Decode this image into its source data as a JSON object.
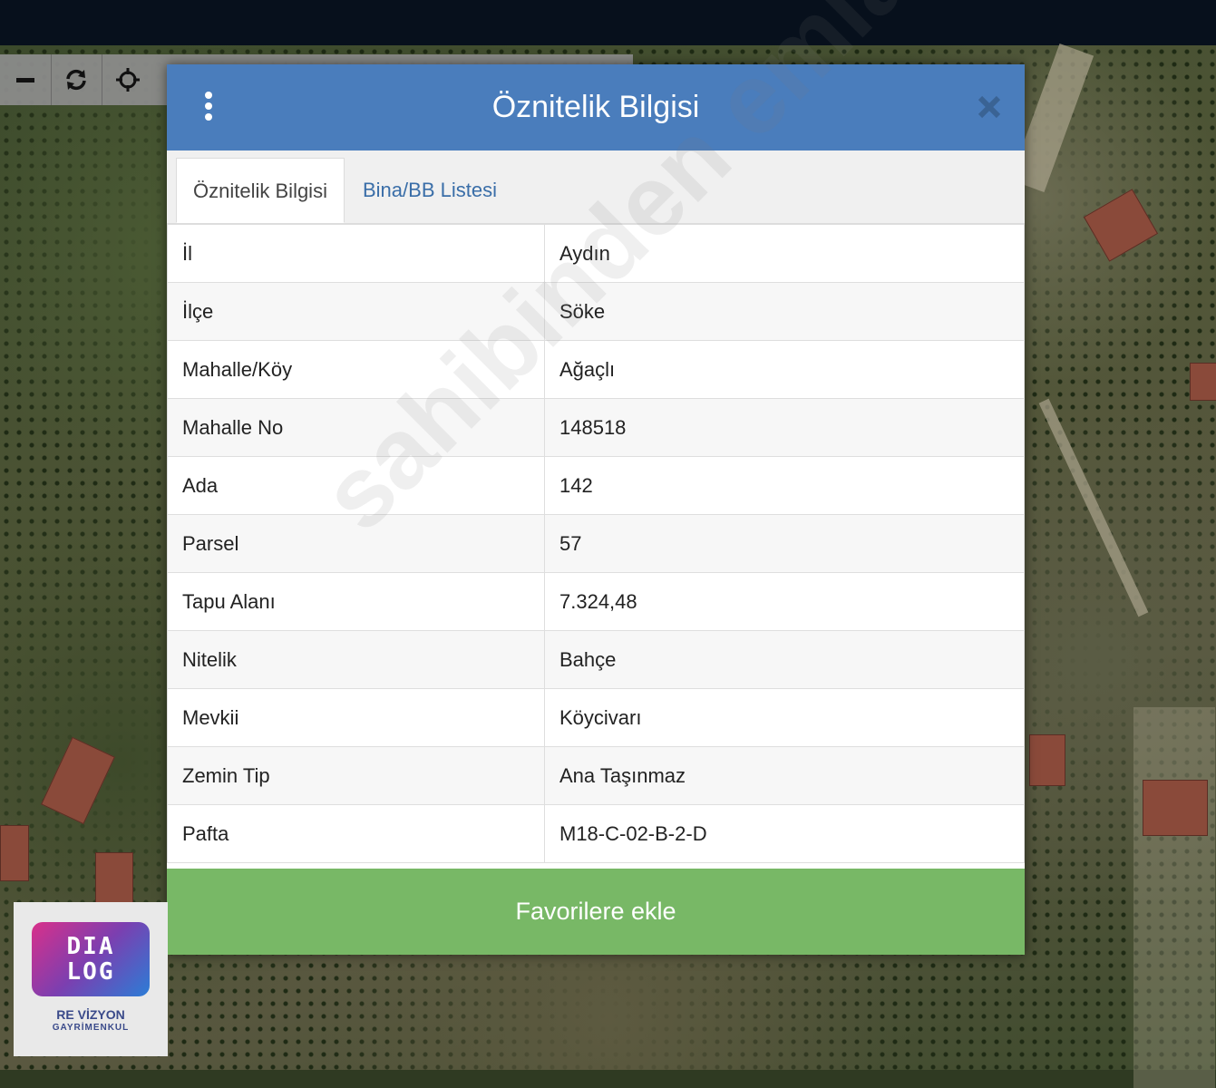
{
  "dialog": {
    "title": "Öznitelik Bilgisi",
    "tabs": [
      {
        "label": "Öznitelik Bilgisi",
        "active": true
      },
      {
        "label": "Bina/BB Listesi",
        "active": false
      }
    ],
    "rows": [
      {
        "key": "İl",
        "value": "Aydın"
      },
      {
        "key": "İlçe",
        "value": "Söke"
      },
      {
        "key": "Mahalle/Köy",
        "value": "Ağaçlı"
      },
      {
        "key": "Mahalle No",
        "value": "148518"
      },
      {
        "key": "Ada",
        "value": "142"
      },
      {
        "key": "Parsel",
        "value": "57"
      },
      {
        "key": "Tapu Alanı",
        "value": "7.324,48"
      },
      {
        "key": "Nitelik",
        "value": "Bahçe"
      },
      {
        "key": "Mevkii",
        "value": "Köycivarı"
      },
      {
        "key": "Zemin Tip",
        "value": "Ana Taşınmaz"
      },
      {
        "key": "Pafta",
        "value": "M18-C-02-B-2-D"
      }
    ],
    "favorite_button": "Favorilere ekle"
  },
  "map_toolbar": {
    "icons": [
      "zoom-out-icon",
      "refresh-icon",
      "locate-icon"
    ]
  },
  "watermark": "sahibinden emlakjet.com",
  "logo": {
    "line1": "DIA",
    "line2": "LOG",
    "subtitle": "RE VİZYON",
    "tagline": "GAYRİMENKUL"
  },
  "colors": {
    "header_blue": "#4a7dbc",
    "button_green": "#78b866",
    "tab_link": "#3a6ea8"
  }
}
